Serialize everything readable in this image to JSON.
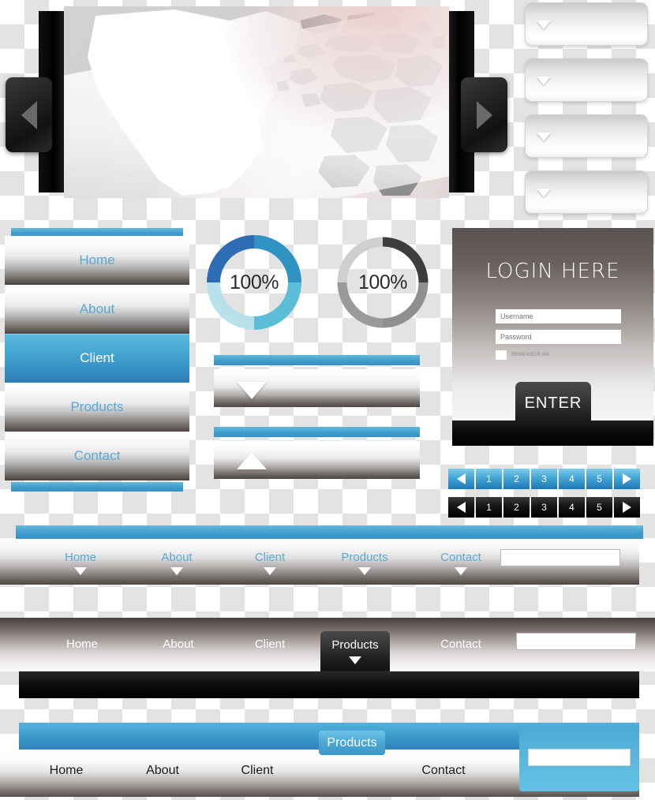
{
  "banner": {
    "prev_icon": "triangle-left-icon",
    "next_icon": "triangle-right-icon",
    "image_alt": "world-map"
  },
  "card_stack": {
    "arrow_icon": "triangle-down-icon",
    "cards": [
      {
        "label": ""
      },
      {
        "label": ""
      },
      {
        "label": ""
      },
      {
        "label": ""
      }
    ]
  },
  "side_menu": {
    "items": [
      {
        "label": "Home",
        "active": false
      },
      {
        "label": "About",
        "active": false
      },
      {
        "label": "Client",
        "active": true
      },
      {
        "label": "Products",
        "active": false
      },
      {
        "label": "Contact",
        "active": false
      }
    ],
    "accent_color": "#3f9ccb",
    "active_color": "#3792c6",
    "link_color": "#59a9d4"
  },
  "donuts": [
    {
      "name": "blue",
      "value": "100%",
      "segments": [
        "#2e6db4",
        "#2f93c4",
        "#5cbdd8",
        "#b8e2ea"
      ]
    },
    {
      "name": "gray",
      "value": "100%",
      "segments": [
        "#3d3d3d",
        "#9a9a9a",
        "#8f8f8f",
        "#cfcfcf"
      ]
    }
  ],
  "accordions": [
    {
      "state": "collapsed",
      "arrow_icon": "triangle-down-icon"
    },
    {
      "state": "expanded",
      "arrow_icon": "triangle-up-icon"
    }
  ],
  "login": {
    "title": "LOGIN HERE",
    "username_placeholder": "Username",
    "username_value": "",
    "password_placeholder": "Password",
    "password_value": "",
    "remember_label": "REMEMBER ME",
    "enter_label": "ENTER"
  },
  "pagination": [
    {
      "style": "blue",
      "prev_icon": "triangle-left-icon",
      "next_icon": "triangle-right-icon",
      "pages": [
        "1",
        "2",
        "3",
        "4",
        "5"
      ]
    },
    {
      "style": "black",
      "prev_icon": "triangle-left-icon",
      "next_icon": "triangle-right-icon",
      "pages": [
        "1",
        "2",
        "3",
        "4",
        "5"
      ]
    }
  ],
  "navbar1": {
    "links": [
      "Home",
      "About",
      "Client",
      "Products",
      "Contact"
    ],
    "caret_icon": "triangle-down-icon",
    "search_value": "",
    "search_placeholder": ""
  },
  "navbar2": {
    "links": [
      "Home",
      "About",
      "Client",
      "Contact"
    ],
    "active_label": "Products",
    "caret_icon": "triangle-down-icon",
    "search_value": "",
    "search_placeholder": ""
  },
  "navbar3": {
    "links": [
      "Home",
      "About",
      "Client",
      "Contact"
    ],
    "active_label": "Products",
    "search_value": "",
    "search_placeholder": ""
  }
}
